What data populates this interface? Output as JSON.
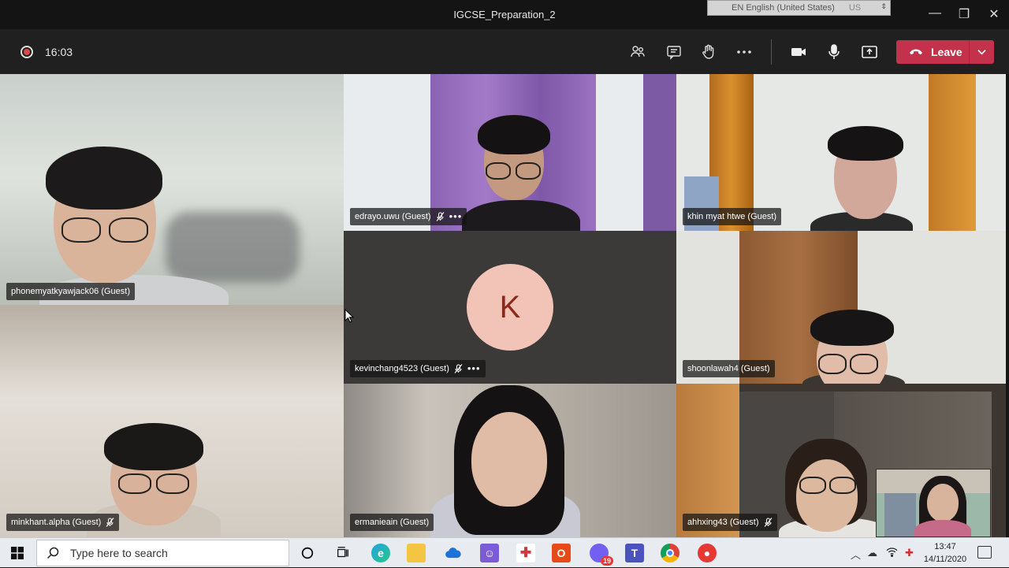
{
  "window": {
    "title": "IGCSE_Preparation_2",
    "language_bar": {
      "language": "EN English (United States)",
      "layout": "US"
    }
  },
  "toolbar": {
    "recording_time": "16:03",
    "leave_label": "Leave",
    "icons": [
      "participants-icon",
      "chat-icon",
      "raise-hand-icon",
      "more-icon",
      "camera-icon",
      "microphone-icon",
      "share-icon"
    ]
  },
  "participants": [
    {
      "name": "phonemyatkyawjack06 (Guest)",
      "muted": false
    },
    {
      "name": "edrayo.uwu (Guest)",
      "muted": true
    },
    {
      "name": "khin myat htwe (Guest)",
      "muted": false
    },
    {
      "name": "kevinchang4523 (Guest)",
      "muted": true,
      "avatar_initial": "K"
    },
    {
      "name": "shoonlawah4 (Guest)",
      "muted": false
    },
    {
      "name": "minkhant.alpha (Guest)",
      "muted": true
    },
    {
      "name": "ermanieain (Guest)",
      "muted": false
    },
    {
      "name": "ahhxing43 (Guest)",
      "muted": true
    }
  ],
  "taskbar": {
    "search_placeholder": "Type here to search",
    "viber_badge": "19",
    "time": "13:47",
    "date": "14/11/2020"
  },
  "colors": {
    "leave": "#c4314b",
    "avatar_bg": "#f2c4b8",
    "avatar_text": "#8a2a1a"
  }
}
